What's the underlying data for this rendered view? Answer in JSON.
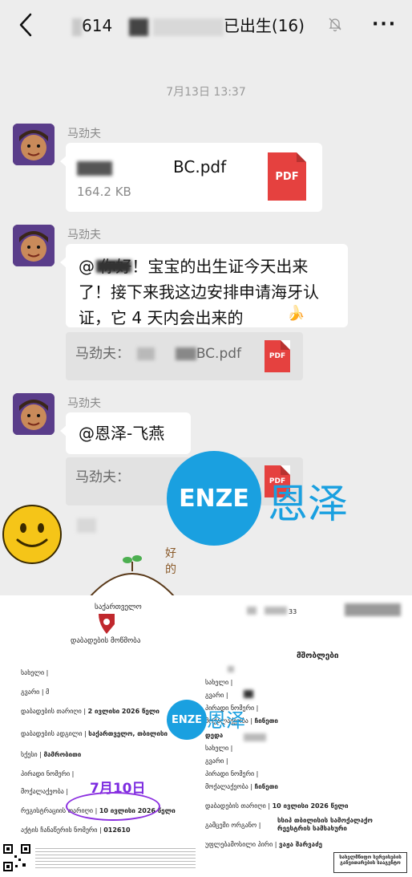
{
  "header": {
    "title_prefix": "614",
    "title_suffix": "已出生(16)",
    "back_icon": "chevron-left-icon",
    "mute_icon": "bell-off-icon",
    "more_label": "···"
  },
  "timestamp": "7月13日 13:37",
  "messages": [
    {
      "sender": "马劲夫",
      "type": "file",
      "file_name_suffix": "BC.pdf",
      "file_size": "164.2 KB",
      "file_icon_label": "PDF"
    },
    {
      "sender": "马劲夫",
      "type": "text",
      "text": "@ 你好！宝宝的出生证今天出来了！接下来我这边安排申请海牙认证，它 4 天内会出来的",
      "quote_prefix": "马劲夫：",
      "quote_suffix": "BC.pdf",
      "quote_icon_label": "PDF"
    },
    {
      "sender": "马劲夫",
      "type": "text",
      "text": "@恩泽-飞燕",
      "quote_prefix": "马劲夫：",
      "quote_suffix": "f",
      "quote_icon_label": "PDF"
    }
  ],
  "watermark": {
    "logo_text": "ENZE",
    "cn_text": "恩泽",
    "color": "#1aa0e0"
  },
  "sticker": {
    "text": "好的"
  },
  "certificate": {
    "top_header": "საქართველო",
    "agency": "დაბადების მოწმობა",
    "ref_num": "33",
    "right_title": "მშობლები",
    "left_rows": [
      {
        "label": "სახელი |",
        "value": ""
      },
      {
        "label": "გვარი |",
        "value": "მ"
      },
      {
        "label": "დაბადების თარიღი |",
        "value": "2 ივლისი 2026 წელი"
      },
      {
        "label": "დაბადების ადგილი |",
        "value": "საქართველო, თბილისი"
      },
      {
        "label": "სქესი |",
        "value": "მამრობითი"
      },
      {
        "label": "პირადი ნომერი |",
        "value": ""
      },
      {
        "label": "მოქალაქეობა |",
        "value": ""
      },
      {
        "label": "რეგისტრაციის თარიღი |",
        "value": "10 ივლისი 2026 წელი"
      },
      {
        "label": "აქტის ჩანაწერის ნომერი |",
        "value": "012610"
      }
    ],
    "right_rows": [
      {
        "label": "სახელი |",
        "value": ""
      },
      {
        "label": "გვარი |",
        "value": ""
      },
      {
        "label": "პირადი ნომერი |",
        "value": ""
      },
      {
        "label": "მოქალაქეობა |",
        "value": "ჩინეთი"
      },
      {
        "label": "დედა",
        "value": ""
      },
      {
        "label": "სახელი |",
        "value": ""
      },
      {
        "label": "გვარი |",
        "value": ""
      },
      {
        "label": "პირადი ნომერი |",
        "value": ""
      },
      {
        "label": "მოქალაქეობა |",
        "value": "ჩინეთი"
      },
      {
        "label": "დაბადების თარიღი |",
        "value": "10 ივლისი 2026 წელი"
      },
      {
        "label": "გამცემი ორგანო |",
        "value": "სსიპ თბილისის სამოქალაქო რეესტრის სამსახური"
      },
      {
        "label": "უფლებამოსილი პირი |",
        "value": "ვაჟა შარვაძე"
      }
    ],
    "annotation": "7月10日",
    "stamp_text": "სახელმწიფო სერვისების განვითარების სააგენტო"
  }
}
